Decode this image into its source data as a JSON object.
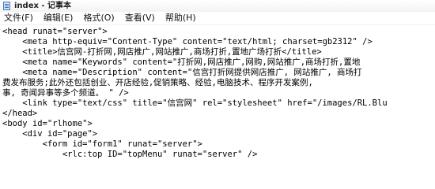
{
  "window": {
    "title": "index - 记事本"
  },
  "menu": {
    "items": [
      "文件(F)",
      "编辑(E)",
      "格式(O)",
      "查看(V)",
      "帮助(H)"
    ]
  },
  "editor": {
    "lines": [
      "<head runat=\"server\">",
      "    <meta http-equiv=\"Content-Type\" content=\"text/html; charset=gb2312\" />",
      "    <title>信宫网-打折网,网店推广,网站推广,商场打折,置地广场打折</title>",
      "    <meta name=\"Keywords\" content=\"打折网,网店推广,网购,网站推广,商场打折,置地",
      "    <meta name=\"Description\" content=\"信宫打折网提供网店推广, 网站推广, 商场打",
      "费发布服务;此外还包括创业、开店经验,促销策略、经验,电脑技术、程序开发案例,",
      "事, 奇闻异事等多个频道。 \" />",
      "    <link type=\"text/css\" title=\"信宫网\" rel=\"stylesheet\" href=\"/images/RL.Blu",
      "</head>",
      "<body id=\"rlhome\">",
      "    <div id=\"page\">",
      "        <form id=\"form1\" runat=\"server\">",
      "            <rlc:top ID=\"topMenu\" runat=\"server\" />"
    ]
  }
}
